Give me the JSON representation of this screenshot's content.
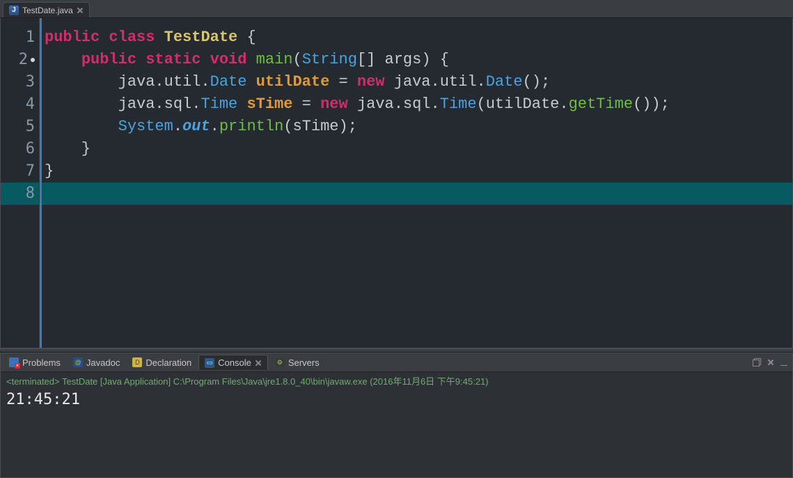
{
  "editor": {
    "tab_filename": "TestDate.java",
    "line_numbers": [
      "1",
      "2",
      "3",
      "4",
      "5",
      "6",
      "7",
      "8"
    ],
    "current_line": 8,
    "breakpoint_line": 2,
    "code_lines": [
      [
        {
          "c": "kw-public",
          "t": "public "
        },
        {
          "c": "kw-class",
          "t": "class "
        },
        {
          "c": "typename",
          "t": "TestDate"
        },
        {
          "c": "punct",
          "t": " {"
        }
      ],
      [
        {
          "c": "default",
          "t": "    "
        },
        {
          "c": "kw-public",
          "t": "public "
        },
        {
          "c": "kw-static",
          "t": "static "
        },
        {
          "c": "kw-void",
          "t": "void "
        },
        {
          "c": "method",
          "t": "main"
        },
        {
          "c": "punct",
          "t": "("
        },
        {
          "c": "type",
          "t": "String"
        },
        {
          "c": "punct",
          "t": "[] "
        },
        {
          "c": "default",
          "t": "args"
        },
        {
          "c": "punct",
          "t": ") {"
        }
      ],
      [
        {
          "c": "default",
          "t": "        java.util."
        },
        {
          "c": "type",
          "t": "Date"
        },
        {
          "c": "default",
          "t": " "
        },
        {
          "c": "var",
          "t": "utilDate"
        },
        {
          "c": "default",
          "t": " = "
        },
        {
          "c": "kw-new",
          "t": "new"
        },
        {
          "c": "default",
          "t": " java.util."
        },
        {
          "c": "type",
          "t": "Date"
        },
        {
          "c": "punct",
          "t": "();"
        }
      ],
      [
        {
          "c": "default",
          "t": "        java.sql."
        },
        {
          "c": "type",
          "t": "Time"
        },
        {
          "c": "default",
          "t": " "
        },
        {
          "c": "var",
          "t": "sTime"
        },
        {
          "c": "default",
          "t": " = "
        },
        {
          "c": "kw-new",
          "t": "new"
        },
        {
          "c": "default",
          "t": " java.sql."
        },
        {
          "c": "type",
          "t": "Time"
        },
        {
          "c": "punct",
          "t": "("
        },
        {
          "c": "default",
          "t": "utilDate."
        },
        {
          "c": "method",
          "t": "getTime"
        },
        {
          "c": "punct",
          "t": "());"
        }
      ],
      [
        {
          "c": "default",
          "t": "        "
        },
        {
          "c": "type",
          "t": "System"
        },
        {
          "c": "default",
          "t": "."
        },
        {
          "c": "field-ital",
          "t": "out"
        },
        {
          "c": "default",
          "t": "."
        },
        {
          "c": "method",
          "t": "println"
        },
        {
          "c": "punct",
          "t": "("
        },
        {
          "c": "default",
          "t": "sTime"
        },
        {
          "c": "punct",
          "t": ");"
        }
      ],
      [
        {
          "c": "punct",
          "t": "    }"
        }
      ],
      [
        {
          "c": "punct",
          "t": "}"
        }
      ],
      [
        {
          "c": "default",
          "t": ""
        }
      ]
    ]
  },
  "bottom": {
    "tabs": {
      "problems": "Problems",
      "javadoc": "Javadoc",
      "declaration": "Declaration",
      "console": "Console",
      "servers": "Servers"
    },
    "console_header": "<terminated> TestDate [Java Application] C:\\Program Files\\Java\\jre1.8.0_40\\bin\\javaw.exe (2016年11月6日 下午9:45:21)",
    "console_output": "21:45:21"
  }
}
